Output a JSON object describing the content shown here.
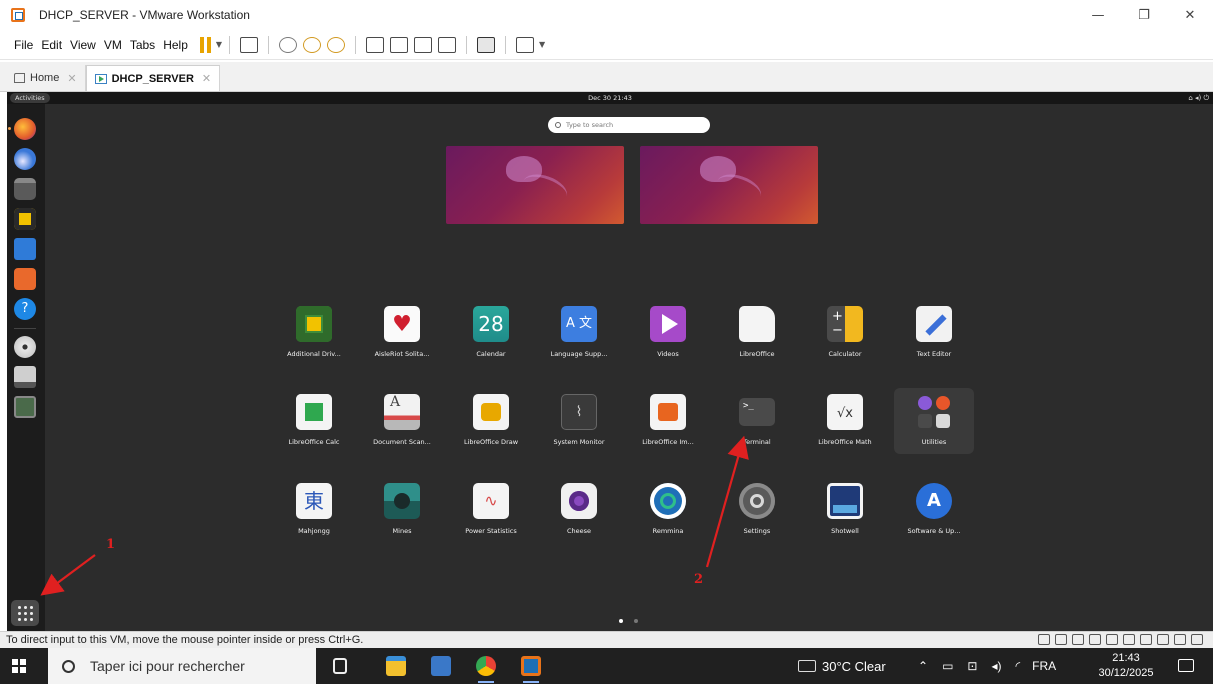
{
  "window": {
    "title": "DHCP_SERVER - VMware Workstation"
  },
  "menu": [
    "File",
    "Edit",
    "View",
    "VM",
    "Tabs",
    "Help"
  ],
  "tabs": [
    {
      "label": "Home",
      "active": false
    },
    {
      "label": "DHCP_SERVER",
      "active": true
    }
  ],
  "vm": {
    "topbar": {
      "activities": "Activities",
      "clock": "Dec 30 21:43"
    },
    "search_placeholder": "Type to search",
    "apps": [
      {
        "label": "Additional Driv...",
        "icon": "chip-icon"
      },
      {
        "label": "AisleRiot Solita...",
        "icon": "cards-icon"
      },
      {
        "label": "Calendar",
        "icon": "calendar-icon",
        "text": "28"
      },
      {
        "label": "Language Supp...",
        "icon": "language-icon",
        "text": "A 文"
      },
      {
        "label": "Videos",
        "icon": "play-icon"
      },
      {
        "label": "LibreOffice",
        "icon": "document-icon"
      },
      {
        "label": "Calculator",
        "icon": "calculator-icon"
      },
      {
        "label": "Text Editor",
        "icon": "pencil-icon"
      },
      {
        "label": "LibreOffice Calc",
        "icon": "spreadsheet-icon"
      },
      {
        "label": "Document Scan...",
        "icon": "scanner-icon",
        "text": "A"
      },
      {
        "label": "LibreOffice Draw",
        "icon": "draw-icon"
      },
      {
        "label": "System Monitor",
        "icon": "monitor-icon"
      },
      {
        "label": "LibreOffice Im...",
        "icon": "impress-icon"
      },
      {
        "label": "Terminal",
        "icon": "terminal-icon",
        "text": ">_"
      },
      {
        "label": "LibreOffice Math",
        "icon": "math-icon",
        "text": "√x"
      },
      {
        "label": "Utilities",
        "icon": "utilities-folder-icon"
      },
      {
        "label": "Mahjongg",
        "icon": "mahjongg-icon",
        "text": "東"
      },
      {
        "label": "Mines",
        "icon": "mines-icon"
      },
      {
        "label": "Power Statistics",
        "icon": "power-chart-icon"
      },
      {
        "label": "Cheese",
        "icon": "camera-icon"
      },
      {
        "label": "Remmina",
        "icon": "remmina-icon"
      },
      {
        "label": "Settings",
        "icon": "gear-icon"
      },
      {
        "label": "Shotwell",
        "icon": "photo-icon"
      },
      {
        "label": "Software & Up...",
        "icon": "software-update-icon",
        "text": "A"
      }
    ]
  },
  "annotations": [
    "1",
    "2"
  ],
  "statusbar": {
    "text": "To direct input to this VM, move the mouse pointer inside or press Ctrl+G."
  },
  "taskbar": {
    "search_placeholder": "Taper ici pour rechercher",
    "weather": "30°C  Clear",
    "lang": "FRA",
    "time": "21:43",
    "date": "30/12/2025"
  },
  "colors": {
    "annotation": "#e02020",
    "vm_bg": "#2c2c2c",
    "dock_bg": "#1c1c1c",
    "taskbar_bg": "#202020"
  }
}
